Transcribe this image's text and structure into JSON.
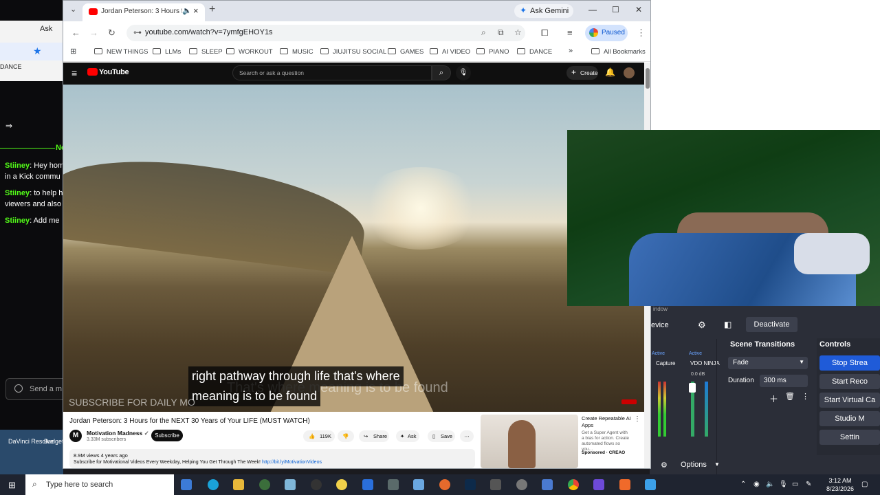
{
  "kick": {
    "ask_label": "Ask",
    "dance_label": "DANCE",
    "header_label": "Ne",
    "messages": [
      {
        "user": "Stiiney",
        "text": ": Hey hom",
        "cont": "in a Kick commu"
      },
      {
        "user": "Stiiney",
        "text": ": to help h",
        "cont": "viewers and also"
      },
      {
        "user": "Stiiney",
        "text": ": Add me",
        "cont": ""
      }
    ],
    "input_placeholder": "Send a m",
    "desktop_icons": [
      "DaVinci Resolve",
      "Budget"
    ]
  },
  "chrome": {
    "tab_title": "Jordan Peterson: 3 Hours fo",
    "gemini_label": "Ask Gemini",
    "url": "youtube.com/watch?v=7ymfgEHOY1s",
    "paused_label": "Paused",
    "bookmarks": [
      "NEW THINGS",
      "LLMs",
      "SLEEP",
      "WORKOUT",
      "MUSIC",
      "JIUJITSU SOCIAL",
      "GAMES",
      "AI VIDEO",
      "PIANO",
      "DANCE"
    ],
    "all_bookmarks": "All Bookmarks"
  },
  "youtube": {
    "logo_text": "YouTube",
    "search_placeholder": "Search or ask a question",
    "create_label": "Create",
    "caption_line1": "right pathway through life that's where",
    "caption_line2": "meaning is to be found",
    "caption_ghost": "That's where meaning is to be found",
    "watermark": "SUBSCRIBE FOR DAILY MO",
    "video_title": "Jordan Peterson: 3 Hours for the NEXT 30 Years of Your LIFE (MUST WATCH)",
    "channel_name": "Motivation Madness",
    "channel_subs": "3.33M subscribers",
    "subscribe_label": "Subscribe",
    "likes": "119K",
    "share_label": "Share",
    "ask_label": "Ask",
    "save_label": "Save",
    "views_meta": "8.9M views  4 years ago",
    "description": "Subscribe for Motivational Videos Every Weekday, Helping You Get Through The Week! ",
    "description_link": "http://bit.ly/MotivationVideos",
    "ad_title": "Create Repeatable AI Apps",
    "ad_desc": "Get a Super Agent with a bias for action. Create automated flows so you…",
    "ad_sponsored": "Sponsored · CREAO"
  },
  "obs": {
    "window_label": "indow",
    "device_label": "evice",
    "deactivate_label": "Deactivate",
    "scene_transitions_title": "Scene Transitions",
    "controls_title": "Controls",
    "active1": "Active",
    "active2": "Active",
    "capture_label": "Capture",
    "vdo_label": "VDO NINJA",
    "db_label": "0.0 dB",
    "transition_value": "Fade",
    "duration_label": "Duration",
    "duration_value": "300 ms",
    "options_label": "Options",
    "controls": [
      "Stop Strea",
      "Start Reco",
      "Start Virtual Ca",
      "Studio M",
      "Settin"
    ]
  },
  "taskbar": {
    "search_placeholder": "Type here to search",
    "time": "3:12 AM",
    "date": "8/23/2026"
  },
  "colors": {
    "youtube_red": "#ff0000",
    "kick_green": "#53fc18",
    "obs_blue": "#1f5bd8",
    "chrome_blue": "#1a73e8"
  }
}
